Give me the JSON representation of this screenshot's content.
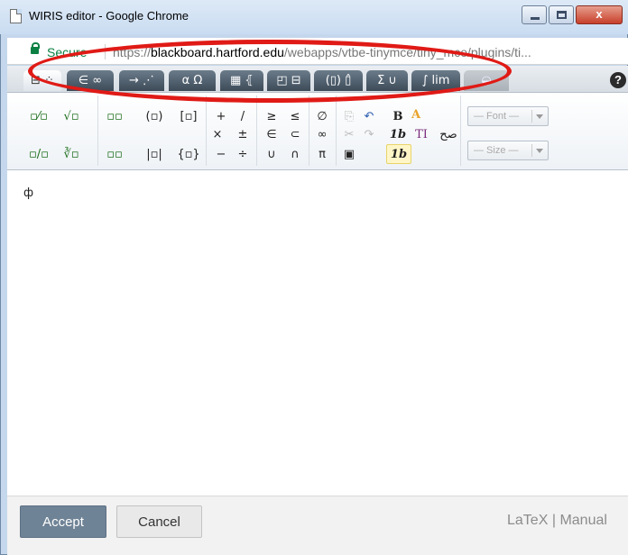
{
  "window": {
    "title": "WIRIS editor - Google Chrome",
    "close_glyph": "x"
  },
  "address_bar": {
    "secure_label": "Secure",
    "url_scheme": "https://",
    "url_host": "blackboard.hartford.edu",
    "url_path": "/webapps/vtbe-tinymce/tiny_mce/plugins/ti..."
  },
  "tabs": [
    {
      "label": "⊟ ⁘",
      "icon": "template-fractions-icon",
      "state": "active"
    },
    {
      "label": "∈ ∞",
      "icon": "symbols-icon",
      "state": "normal"
    },
    {
      "label": "→ ⋰",
      "icon": "arrows-icon",
      "state": "normal"
    },
    {
      "label": "α Ω",
      "icon": "greek-letters-icon",
      "state": "normal"
    },
    {
      "label": "▦ ⦃",
      "icon": "matrices-icon",
      "state": "normal"
    },
    {
      "label": "◰ ⊟",
      "icon": "scripts-icon",
      "state": "normal"
    },
    {
      "label": "(▯) ▯̂",
      "icon": "decorations-icon",
      "state": "normal"
    },
    {
      "label": "Σ ∪",
      "icon": "big-operators-icon",
      "state": "normal"
    },
    {
      "label": "∫ lim",
      "icon": "calculus-icon",
      "state": "normal"
    },
    {
      "label": "◒",
      "icon": "chemistry-icon",
      "state": "disabled"
    }
  ],
  "help_label": "?",
  "toolbar": {
    "fraction": "▫⁄▫",
    "sqrt": "√▫",
    "superscript": "▫▫",
    "parens": "(▫)",
    "brackets": "[▫]",
    "plus": "+",
    "slash": "/",
    "geq": "≥",
    "leq": "≤",
    "emptyset": "∅",
    "copy": "⎘",
    "undo": "↶",
    "bold": "B",
    "color": "A",
    "bevelled_fraction": "▫/▫",
    "nth_root": "∛▫",
    "subscript": "▫▫",
    "abs": "|▫|",
    "braces": "{▫}",
    "times": "×",
    "plusminus": "±",
    "minus": "−",
    "divide": "÷",
    "in": "∈",
    "subset": "⊂",
    "cup": "∪",
    "cap": "∩",
    "infinity": "∞",
    "pi": "π",
    "cut": "✂",
    "redo": "↷",
    "paste": "▣",
    "italic_1b": "1b",
    "upright_1b": "1b",
    "text_ti": "TI",
    "rtl": "ﺻﺢ",
    "font_placeholder": "— Font —",
    "size_placeholder": "— Size —"
  },
  "canvas": {
    "caret": "ф"
  },
  "footer": {
    "accept_label": "Accept",
    "cancel_label": "Cancel",
    "latex_link": "LaTeX",
    "separator": "|",
    "manual_link": "Manual"
  },
  "colors": {
    "annotation_red": "#e01a16",
    "secure_green": "#0b8043",
    "accept_bg": "#6f8396",
    "tab_dark": "#3d4b58"
  }
}
